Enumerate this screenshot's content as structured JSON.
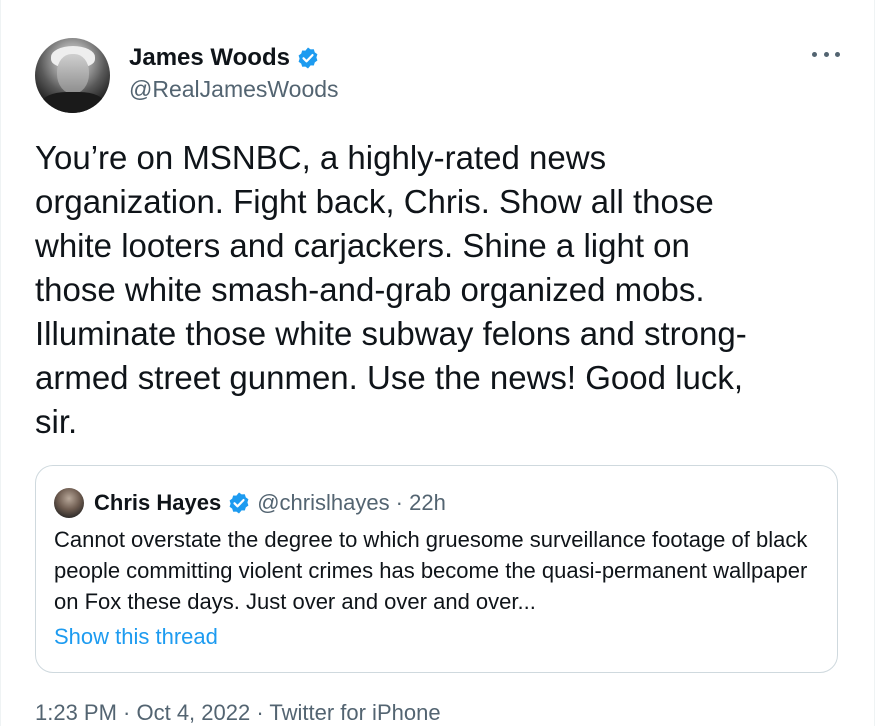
{
  "author": {
    "name": "James Woods",
    "handle": "@RealJamesWoods",
    "verified": true,
    "verified_color": "#1d9bf0"
  },
  "tweet": {
    "text": "You’re on MSNBC, a highly-rated news\norganization. Fight back, Chris. Show all those\nwhite looters and carjackers. Shine a light on\nthose white smash-and-grab organized mobs.\nIlluminate those white subway felons and strong-\narmed street gunmen. Use the news! Good luck,\nsir."
  },
  "quote": {
    "name": "Chris Hayes",
    "verified": true,
    "handle_time": "@chrislhayes · 22h",
    "text": "Cannot overstate the degree to which gruesome surveillance footage of black people committing violent crimes has become the quasi-permanent wallpaper on Fox these days. Just over and over and over...",
    "show_thread_label": "Show this thread"
  },
  "footer": {
    "timestamp": "1:23 PM · Oct 4, 2022 · Twitter for iPhone"
  },
  "icons": {
    "more": "more-horizontal-icon",
    "verified": "verified-badge-icon"
  },
  "colors": {
    "link": "#1d9bf0",
    "secondary_text": "#536471",
    "primary_text": "#0f1419",
    "border": "#cfd9de"
  }
}
